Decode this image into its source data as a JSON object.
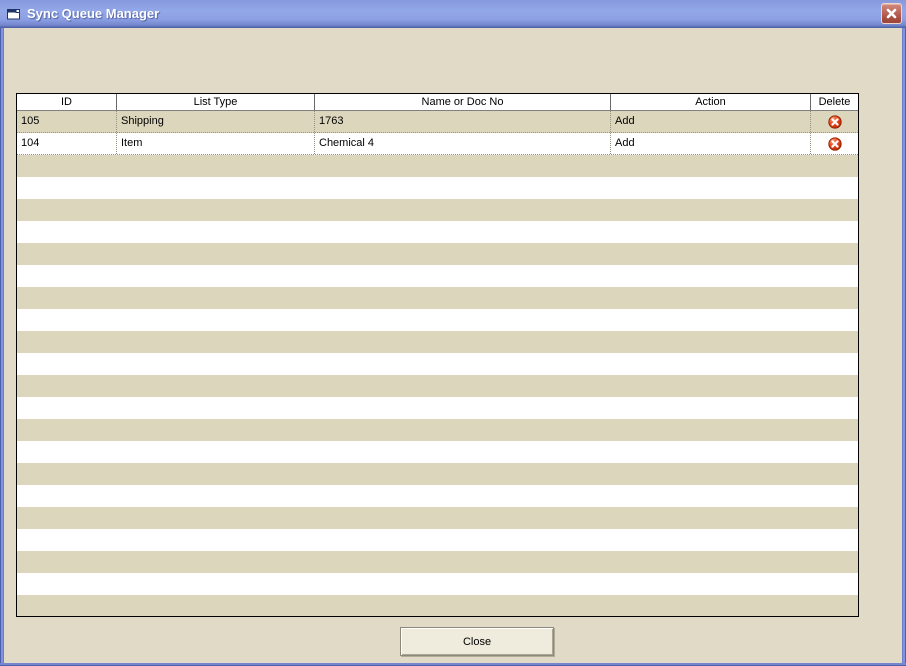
{
  "window": {
    "title": "Sync Queue Manager"
  },
  "grid": {
    "columns": [
      "ID",
      "List Type",
      "Name or Doc No",
      "Action",
      "Delete"
    ],
    "rows": [
      {
        "id": "105",
        "list_type": "Shipping",
        "name_or_doc_no": "1763",
        "action": "Add"
      },
      {
        "id": "104",
        "list_type": "Item",
        "name_or_doc_no": "Chemical 4",
        "action": "Add"
      }
    ]
  },
  "footer": {
    "close_label": "Close"
  },
  "icons": {
    "titlebar": "form-icon",
    "titlebar_close": "close-icon",
    "row_delete": "delete-icon"
  },
  "colors": {
    "titlebar_blue": "#8DA2E6",
    "window_border_blue": "#7585CE",
    "content_background": "#E0DAC7",
    "stripe_tan": "#DCD6BC",
    "grid_header_background": "#FFFFFF",
    "grid_border": "#000000",
    "delete_icon_red": "#D93511",
    "close_button_red": "#B55A4C",
    "text_color": "#000000"
  }
}
